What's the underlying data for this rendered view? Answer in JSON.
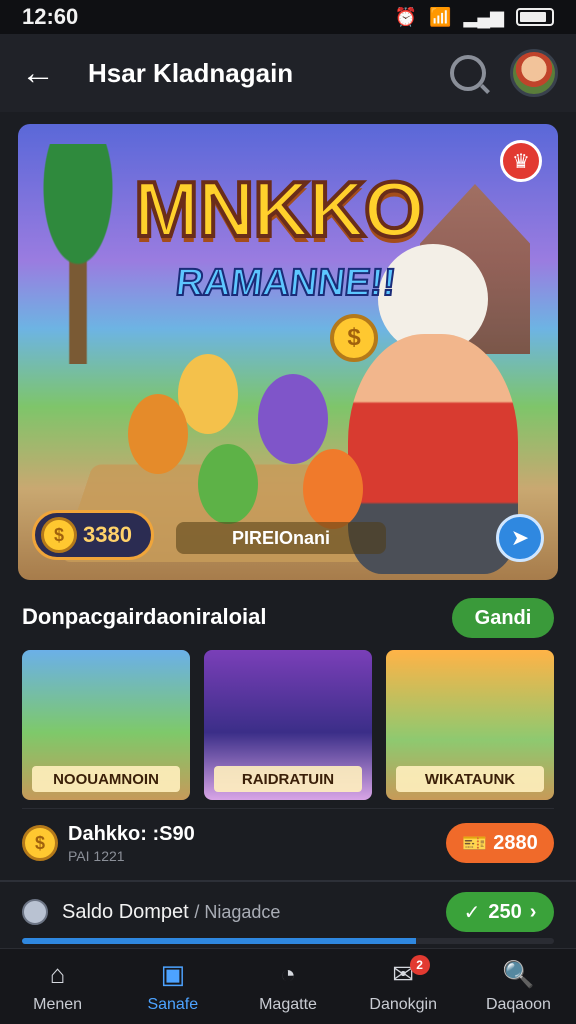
{
  "status": {
    "time": "12:60"
  },
  "app_bar": {
    "title": "Hsar Kladnagain"
  },
  "hero": {
    "title": "MNKKO",
    "subtitle": "RAMANNE!!",
    "coin_value": "3380",
    "play_label": "PIREIOnani"
  },
  "section": {
    "title": "Donpacgairdaoniraloial",
    "button_label": "Gandi"
  },
  "games": [
    {
      "label": "NOOUAMNOIN"
    },
    {
      "label": "RAIDRATUIN"
    },
    {
      "label": "WIKATAUNK"
    }
  ],
  "coin_row": {
    "title": "Dahkko: :S90",
    "subtitle": "PAI 1221",
    "button_value": "2880"
  },
  "wallet_row": {
    "label": "Saldo Dompet",
    "label_muted": "/ Niagadce",
    "button_value": "250",
    "progress_fraction": 0.74
  },
  "nav": [
    {
      "label": "Menen"
    },
    {
      "label": "Sanafe"
    },
    {
      "label": "Magatte"
    },
    {
      "label": "Danokgin",
      "badge": "2"
    },
    {
      "label": "Daqaoon"
    }
  ],
  "colors": {
    "accent_blue": "#2f88e0",
    "accent_green": "#3aa23a",
    "accent_orange": "#f06a2a",
    "background": "#1b1d22"
  }
}
